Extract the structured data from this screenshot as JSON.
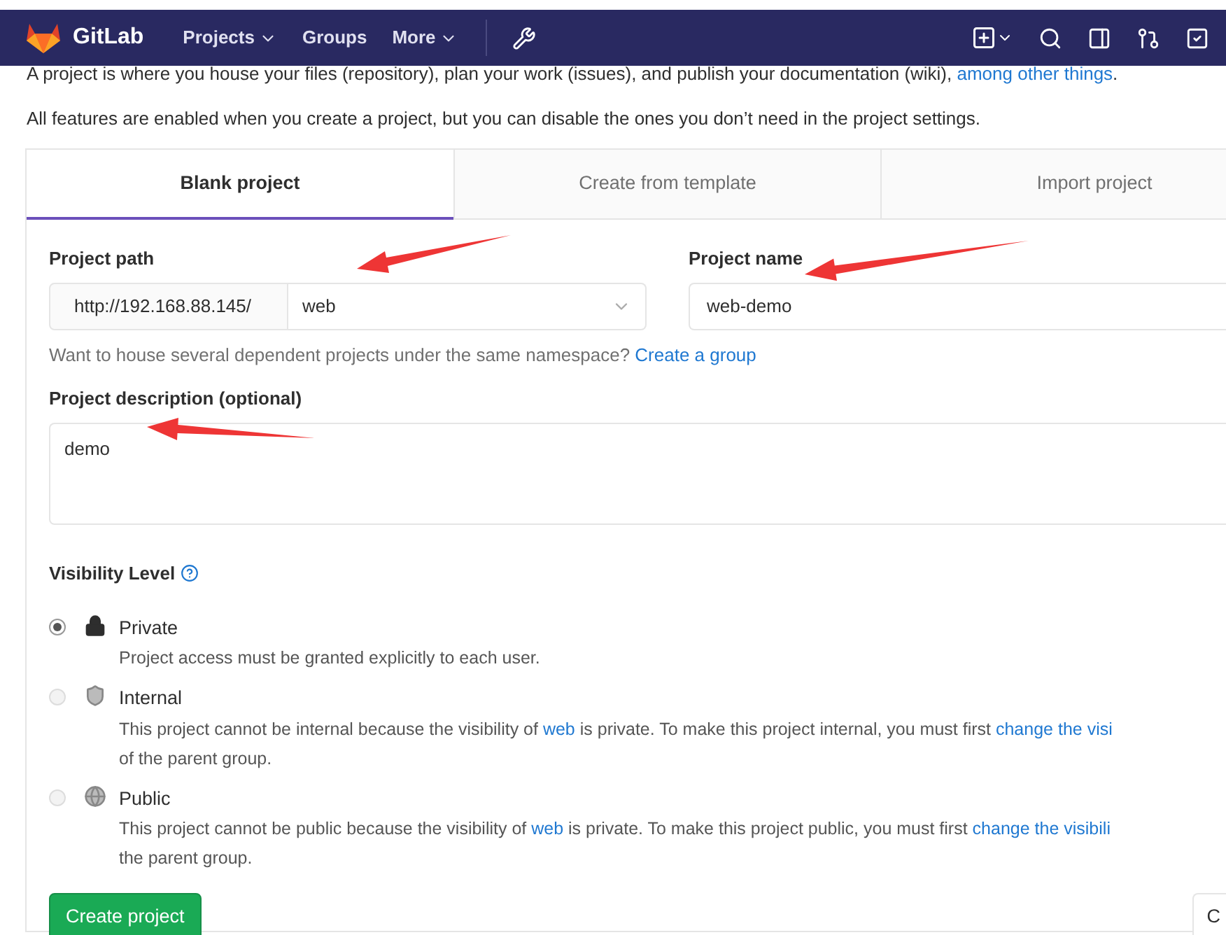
{
  "navbar": {
    "brand": "GitLab",
    "menus": [
      {
        "label": "Projects",
        "dropdown": true
      },
      {
        "label": "Groups",
        "dropdown": false
      },
      {
        "label": "More",
        "dropdown": true
      }
    ]
  },
  "intro": [
    [
      {
        "kind": "text",
        "text": "A project is where you house your files (repository), plan your work (issues), and publish your documentation (wiki), "
      },
      {
        "kind": "link",
        "text": "among other things"
      },
      {
        "kind": "text",
        "text": "."
      }
    ],
    [
      {
        "kind": "text",
        "text": "All features are enabled when you create a project, but you can disable the ones you don’t need in the project settings."
      }
    ]
  ],
  "tabs": [
    {
      "label": "Blank project",
      "selected": true
    },
    {
      "label": "Create from template",
      "selected": false
    },
    {
      "label": "Import project",
      "selected": false
    }
  ],
  "project_path": {
    "label": "Project path",
    "prefix": "http://192.168.88.145/",
    "value": "web"
  },
  "project_name": {
    "label": "Project name",
    "value": "web-demo"
  },
  "namespace_hint": [
    {
      "kind": "text",
      "text": "Want to house several dependent projects under the same namespace? "
    },
    {
      "kind": "link",
      "text": "Create a group"
    }
  ],
  "description": {
    "label": "Project description (optional)",
    "value": "demo"
  },
  "visibility": {
    "label": "Visibility Level",
    "options": [
      {
        "kind": "private",
        "label": "Private",
        "selected": true,
        "disabled": false,
        "lines": [
          [
            {
              "kind": "text",
              "text": "Project access must be granted explicitly to each user."
            }
          ]
        ]
      },
      {
        "kind": "internal",
        "label": "Internal",
        "selected": false,
        "disabled": true,
        "lines": [
          [
            {
              "kind": "text",
              "text": "This project cannot be internal because the visibility of "
            },
            {
              "kind": "link",
              "text": "web"
            },
            {
              "kind": "text",
              "text": " is private. To make this project internal, you must first "
            },
            {
              "kind": "link",
              "text": "change the visi"
            }
          ],
          [
            {
              "kind": "text",
              "text": "of the parent group."
            }
          ]
        ]
      },
      {
        "kind": "public",
        "label": "Public",
        "selected": false,
        "disabled": true,
        "lines": [
          [
            {
              "kind": "text",
              "text": "This project cannot be public because the visibility of "
            },
            {
              "kind": "link",
              "text": "web"
            },
            {
              "kind": "text",
              "text": " is private. To make this project public, you must first "
            },
            {
              "kind": "link",
              "text": "change the visibili"
            }
          ],
          [
            {
              "kind": "text",
              "text": "the parent group."
            }
          ]
        ]
      }
    ]
  },
  "buttons": [
    {
      "label": "Create project",
      "kind": "primary"
    },
    {
      "label": "C",
      "kind": "secondary"
    }
  ]
}
